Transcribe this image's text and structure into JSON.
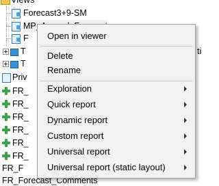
{
  "tree": {
    "root_label": "Views",
    "items": [
      {
        "label": "Forecast3+9-SM"
      },
      {
        "label": "MP_Accrual_Forecast"
      },
      {
        "label": "F"
      },
      {
        "label": "T",
        "trail": "ti"
      },
      {
        "label": "T"
      },
      {
        "label": "Priv"
      },
      {
        "label": "FR_"
      },
      {
        "label": "FR_"
      },
      {
        "label": "FR_"
      },
      {
        "label": "FR_"
      },
      {
        "label": "FR_"
      },
      {
        "label": "FR_"
      },
      {
        "label": "FR_F"
      },
      {
        "label": "FR_Forecast_Comments"
      }
    ]
  },
  "context_menu": {
    "items": [
      {
        "label": "Open in viewer"
      },
      {
        "label": "Delete"
      },
      {
        "label": "Rename"
      },
      {
        "label": "Exploration"
      },
      {
        "label": "Quick report"
      },
      {
        "label": "Dynamic report"
      },
      {
        "label": "Custom report"
      },
      {
        "label": "Universal report"
      },
      {
        "label": "Universal report (static layout)"
      }
    ]
  },
  "colors": {
    "menu_bg": "#f2f2f2",
    "menu_border": "#a0a0a0",
    "folder": "#f2c94c",
    "view_icon": "#3a73b8",
    "green_icon": "#3fa34d"
  }
}
